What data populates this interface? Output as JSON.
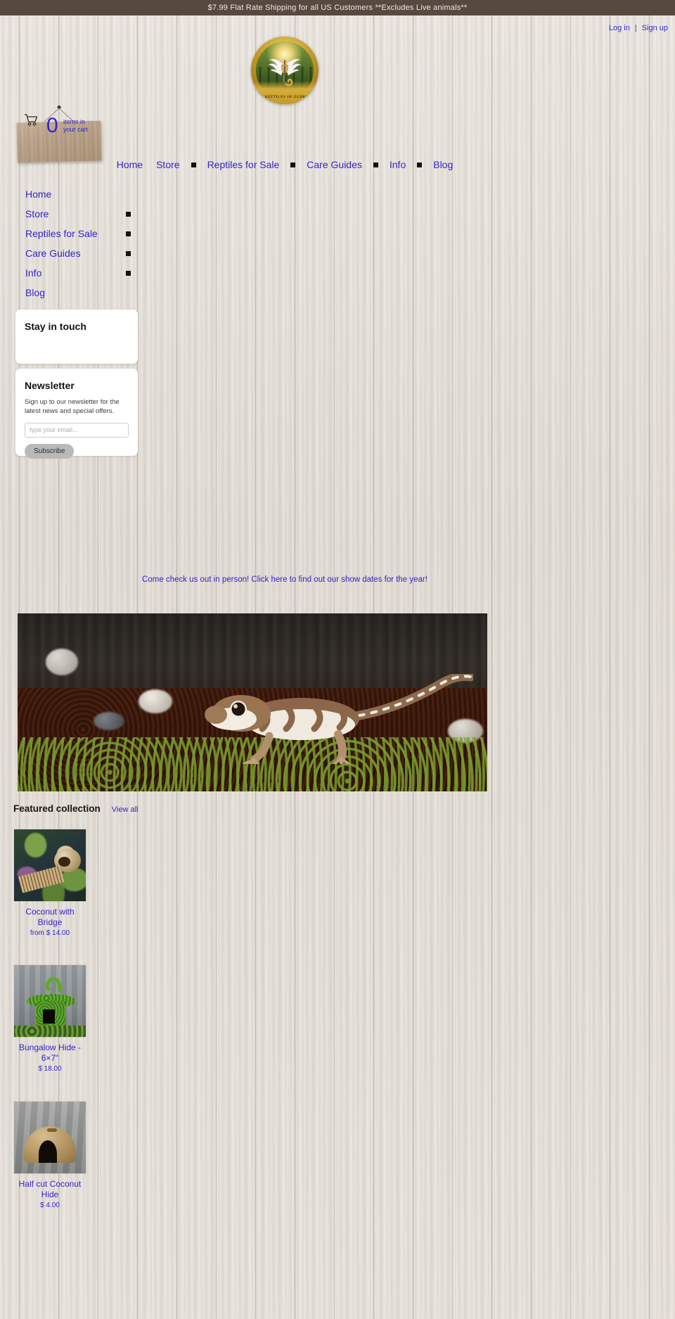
{
  "announcement": {
    "text": "$7.99 Flat Rate Shipping for all US Customers **Excludes Live animals**"
  },
  "account": {
    "login_label": "Log in",
    "separator": "|",
    "signup_label": "Sign up"
  },
  "logo": {
    "ring_text": "THE REPTILES OF ELDRADO",
    "alt": "winged-reptile-crest-logo"
  },
  "cart": {
    "count": "0",
    "label_line1": "items in",
    "label_line2": "your cart",
    "icon": "shopping-cart-icon"
  },
  "main_nav": {
    "items": [
      {
        "label": "Home",
        "has_submenu": false
      },
      {
        "label": "Store",
        "has_submenu": true
      },
      {
        "label": "Reptiles for Sale",
        "has_submenu": true
      },
      {
        "label": "Care Guides",
        "has_submenu": true
      },
      {
        "label": "Info",
        "has_submenu": true
      },
      {
        "label": "Blog",
        "has_submenu": false
      }
    ]
  },
  "sidebar": {
    "items": [
      {
        "label": "Home",
        "has_submenu": false
      },
      {
        "label": "Store",
        "has_submenu": true
      },
      {
        "label": "Reptiles for Sale",
        "has_submenu": true
      },
      {
        "label": "Care Guides",
        "has_submenu": true
      },
      {
        "label": "Info",
        "has_submenu": true
      },
      {
        "label": "Blog",
        "has_submenu": false
      }
    ],
    "stay_in_touch": {
      "title": "Stay in touch"
    },
    "newsletter": {
      "title": "Newsletter",
      "description": "Sign up to our newsletter for the latest news and special offers.",
      "input_value": "",
      "input_placeholder": "type your email...",
      "button_label": "Subscribe"
    }
  },
  "promo": {
    "link_text": "Come check us out in person! Click here to find out our show dates for the year!"
  },
  "hero": {
    "alt": "gecko-on-moss-banner"
  },
  "featured": {
    "title": "Featured collection",
    "view_all_label": "View all",
    "products": [
      {
        "title": "Coconut with Bridge",
        "price": "from $ 14.00",
        "image_alt": "coconut-with-bridge-product-image"
      },
      {
        "title": "Bungalow Hide - 6×7\"",
        "price": "$ 18.00",
        "image_alt": "bungalow-hide-product-image"
      },
      {
        "title": "Half cut Coconut Hide",
        "price": "$ 4.00",
        "image_alt": "half-cut-coconut-hide-product-image"
      }
    ]
  },
  "colors": {
    "announce_bg": "#574940",
    "link_blue": "#3225cc",
    "panel_bg": "#ffffff",
    "button_grey": "#b9b9b9"
  }
}
